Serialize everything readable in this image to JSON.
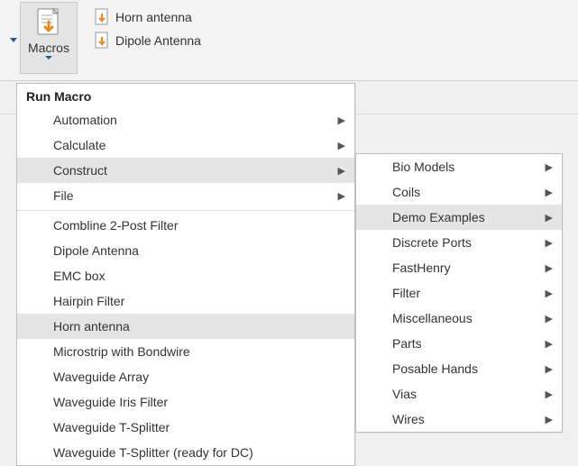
{
  "ribbon": {
    "macros_label": "Macros",
    "recent": [
      {
        "label": "Horn antenna"
      },
      {
        "label": "Dipole Antenna"
      }
    ]
  },
  "menu": {
    "title": "Run Macro",
    "top_items": [
      {
        "label": "Automation",
        "submenu": true,
        "highlight": false
      },
      {
        "label": "Calculate",
        "submenu": true,
        "highlight": false
      },
      {
        "label": "Construct",
        "submenu": true,
        "highlight": true
      },
      {
        "label": "File",
        "submenu": true,
        "highlight": false
      }
    ],
    "bottom_items": [
      {
        "label": "Combline 2-Post Filter",
        "highlight": false
      },
      {
        "label": "Dipole Antenna",
        "highlight": false
      },
      {
        "label": "EMC box",
        "highlight": false
      },
      {
        "label": "Hairpin Filter",
        "highlight": false
      },
      {
        "label": "Horn antenna",
        "highlight": true
      },
      {
        "label": "Microstrip with Bondwire",
        "highlight": false
      },
      {
        "label": "Waveguide Array",
        "highlight": false
      },
      {
        "label": "Waveguide Iris Filter",
        "highlight": false
      },
      {
        "label": "Waveguide T-Splitter",
        "highlight": false
      },
      {
        "label": "Waveguide T-Splitter (ready for DC)",
        "highlight": false
      }
    ]
  },
  "submenu": {
    "items": [
      {
        "label": "Bio Models",
        "submenu": true,
        "highlight": false
      },
      {
        "label": "Coils",
        "submenu": true,
        "highlight": false
      },
      {
        "label": "Demo Examples",
        "submenu": true,
        "highlight": true
      },
      {
        "label": "Discrete Ports",
        "submenu": true,
        "highlight": false
      },
      {
        "label": "FastHenry",
        "submenu": true,
        "highlight": false
      },
      {
        "label": "Filter",
        "submenu": true,
        "highlight": false
      },
      {
        "label": "Miscellaneous",
        "submenu": true,
        "highlight": false
      },
      {
        "label": "Parts",
        "submenu": true,
        "highlight": false
      },
      {
        "label": "Posable Hands",
        "submenu": true,
        "highlight": false
      },
      {
        "label": "Vias",
        "submenu": true,
        "highlight": false
      },
      {
        "label": "Wires",
        "submenu": true,
        "highlight": false
      }
    ]
  }
}
